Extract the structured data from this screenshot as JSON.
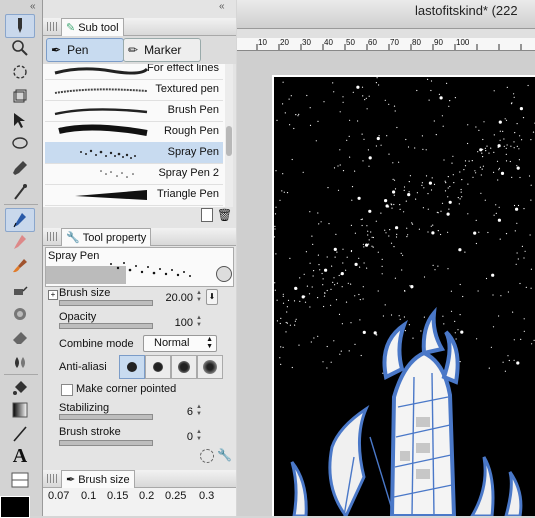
{
  "document_title": "lastofitskind* (222",
  "subtool": {
    "title": "Sub tool",
    "tabs": [
      {
        "label": "Pen"
      },
      {
        "label": "Marker"
      }
    ],
    "brushes": [
      {
        "name": "For effect lines"
      },
      {
        "name": "Textured pen"
      },
      {
        "name": "Brush Pen"
      },
      {
        "name": "Rough Pen"
      },
      {
        "name": "Spray Pen"
      },
      {
        "name": "Spray Pen 2"
      },
      {
        "name": "Triangle Pen"
      }
    ]
  },
  "tool_property": {
    "title": "Tool property",
    "preview_name": "Spray Pen",
    "brush_size_label": "Brush size",
    "brush_size_value": "20.00",
    "opacity_label": "Opacity",
    "opacity_value": "100",
    "combine_mode_label": "Combine mode",
    "combine_mode_value": "Normal",
    "anti_alias_label": "Anti-aliasi",
    "corner_label": "Make corner pointed",
    "stabilizing_label": "Stabilizing",
    "stabilizing_value": "6",
    "brush_stroke_label": "Brush stroke",
    "brush_stroke_value": "0"
  },
  "brush_size_panel": {
    "title": "Brush size",
    "sizes": [
      "0.07",
      "0.1",
      "0.15",
      "0.2",
      "0.25",
      "0.3"
    ]
  },
  "ruler": {
    "ticks": [
      "10",
      "20",
      "30",
      "40",
      "50",
      "60",
      "70",
      "80",
      "90",
      "100"
    ]
  },
  "colors": {
    "accent_selected": "#c8dbf0",
    "panel_bg": "#e4e4e4",
    "sky": "#000000",
    "tower_line": "#4a78c8"
  }
}
